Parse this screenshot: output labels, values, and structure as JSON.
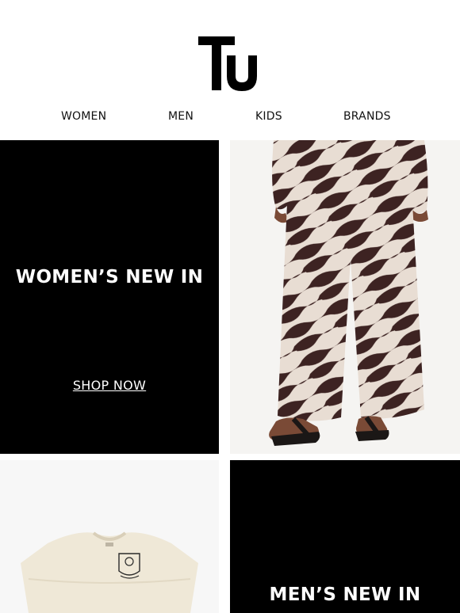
{
  "brand": {
    "logo_text": "Tu"
  },
  "nav": {
    "items": [
      {
        "label": "WOMEN"
      },
      {
        "label": "MEN"
      },
      {
        "label": "KIDS"
      },
      {
        "label": "BRANDS"
      }
    ]
  },
  "promos": {
    "womens": {
      "heading": "WOMEN’S NEW IN",
      "cta": "SHOP NOW"
    },
    "mens": {
      "heading": "MEN’S NEW IN"
    }
  },
  "colors": {
    "tile_background": "#000000",
    "tile_text": "#ffffff",
    "zebra_dark": "#3d2322",
    "zebra_light": "#e8ddd3",
    "tee_cream": "#efe8d7"
  },
  "images": {
    "womens_photo": "zebra-print-wide-leg-trousers",
    "mens_photo": "cream-graphic-t-shirt"
  }
}
